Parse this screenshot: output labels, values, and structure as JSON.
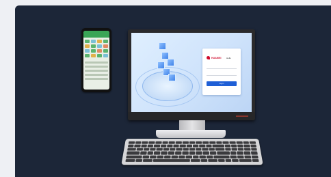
{
  "login": {
    "brand": "HUAWEI",
    "greeting": "Hello",
    "username_field": "",
    "password_field": "",
    "button": "Log In"
  },
  "colors": {
    "card_background": "#1c2638",
    "brand_red": "#cf0a2c",
    "button_blue": "#1f5fd6",
    "phone_header_green": "#3aa556"
  },
  "icons": [
    "huawei-logo-icon"
  ]
}
